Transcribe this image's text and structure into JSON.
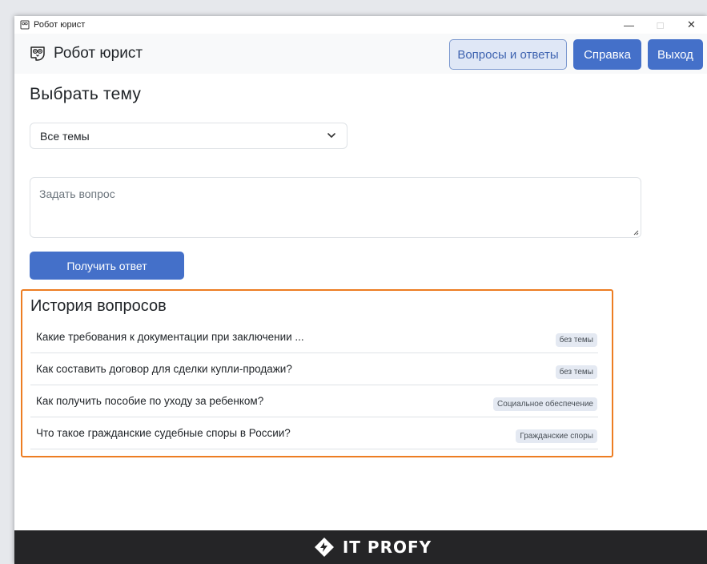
{
  "window": {
    "title": "Робот юрист",
    "minimize": "—",
    "maximize": "□",
    "close": "✕"
  },
  "navbar": {
    "brand": "Робот юрист",
    "faq_label": "Вопросы и ответы",
    "help_label": "Справка",
    "exit_label": "Выход"
  },
  "topic": {
    "heading": "Выбрать тему",
    "selected": "Все темы"
  },
  "question": {
    "placeholder": "Задать вопрос",
    "submit_label": "Получить ответ"
  },
  "history": {
    "heading": "История вопросов",
    "items": [
      {
        "question": "Какие требования к документации при заключении ...",
        "tag": "без темы"
      },
      {
        "question": "Как составить договор для сделки купли-продажи?",
        "tag": "без темы"
      },
      {
        "question": "Как получить пособие по уходу за ребенком?",
        "tag": "Социальное обеспечение"
      },
      {
        "question": "Что такое гражданские судебные споры в России?",
        "tag": "Гражданские споры"
      }
    ]
  },
  "footer": {
    "logo_text": "IT PROFY"
  },
  "colors": {
    "primary": "#4470c9",
    "highlight_border": "#ed7d22",
    "footer_bg": "#252527"
  }
}
